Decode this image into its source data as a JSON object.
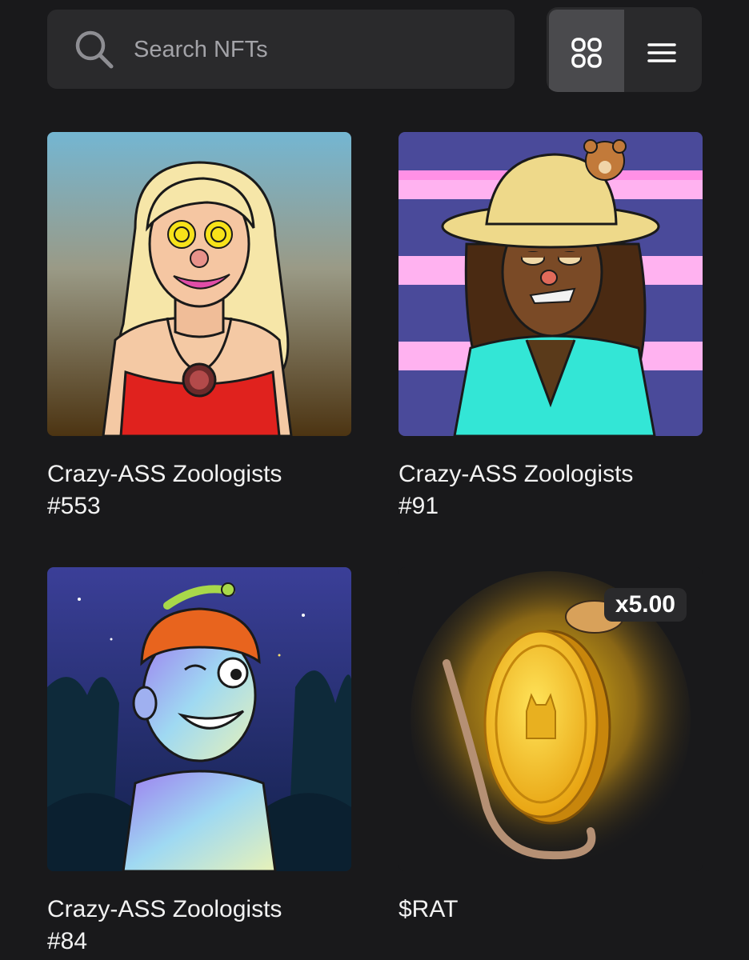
{
  "search": {
    "placeholder": "Search NFTs",
    "icon": "search-icon"
  },
  "view_toggle": {
    "active": "grid",
    "options": [
      "grid-view-icon",
      "list-view-icon"
    ]
  },
  "nfts": [
    {
      "name_line1": "Crazy-ASS Zoologists",
      "name_line2": "#553"
    },
    {
      "name_line1": "Crazy-ASS Zoologists",
      "name_line2": "#91"
    },
    {
      "name_line1": "Crazy-ASS Zoologists",
      "name_line2": "#84"
    },
    {
      "name_line1": "$RAT",
      "name_line2": "",
      "badge": "x5.00"
    }
  ],
  "colors": {
    "background": "#19191b",
    "surface": "#2a2a2c",
    "active_toggle": "#4a4a4d",
    "text": "#f2f2f2"
  }
}
